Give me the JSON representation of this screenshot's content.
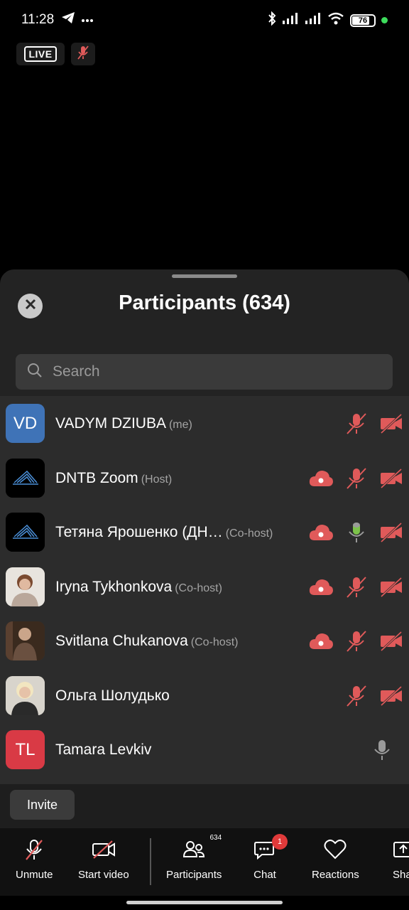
{
  "status_bar": {
    "time": "11:28",
    "battery": "76",
    "icons": [
      "telegram-icon",
      "more-dots-icon",
      "bluetooth-icon",
      "signal-icon",
      "signal-icon",
      "wifi-icon",
      "battery-icon"
    ]
  },
  "top": {
    "live_label": "LIVE"
  },
  "panel": {
    "title": "Participants (634)",
    "search_placeholder": "Search"
  },
  "participants": [
    {
      "name": "VADYM DZIUBA",
      "role": "(me)",
      "initials": "VD",
      "avatar_color": "#3f73b7",
      "mic": "muted",
      "video": "off",
      "cloud": false
    },
    {
      "name": "DNTB Zoom",
      "role": "(Host)",
      "initials": "",
      "avatar_color": "#000000",
      "mic": "muted",
      "video": "off",
      "cloud": true
    },
    {
      "name": "Тетяна Ярошенко (ДН…",
      "role": "(Co-host)",
      "initials": "",
      "avatar_color": "#000000",
      "mic": "active",
      "video": "off",
      "cloud": true
    },
    {
      "name": "Iryna Tykhonkova",
      "role": "(Co-host)",
      "initials": "",
      "avatar_color": "#d9d2c8",
      "mic": "muted",
      "video": "off",
      "cloud": true
    },
    {
      "name": "Svitlana Chukanova",
      "role": "(Co-host)",
      "initials": "",
      "avatar_color": "#4a3a2e",
      "mic": "muted",
      "video": "off",
      "cloud": true
    },
    {
      "name": "Ольга Шолудько",
      "role": "",
      "initials": "",
      "avatar_color": "#d8d4cc",
      "mic": "muted",
      "video": "off",
      "cloud": false
    },
    {
      "name": "Tamara Levkiv",
      "role": "",
      "initials": "TL",
      "avatar_color": "#d93a45",
      "mic": "idle",
      "video": "none",
      "cloud": false
    }
  ],
  "invite_label": "Invite",
  "toolbar": {
    "unmute": "Unmute",
    "start_video": "Start video",
    "participants": "Participants",
    "participants_count": "634",
    "chat": "Chat",
    "chat_badge": "1",
    "reactions": "Reactions",
    "share": "Sha"
  },
  "colors": {
    "muted_red": "#e05a5a",
    "mic_green": "#7cc24a",
    "panel_bg": "#232323",
    "list_bg": "#2c2c2c"
  }
}
